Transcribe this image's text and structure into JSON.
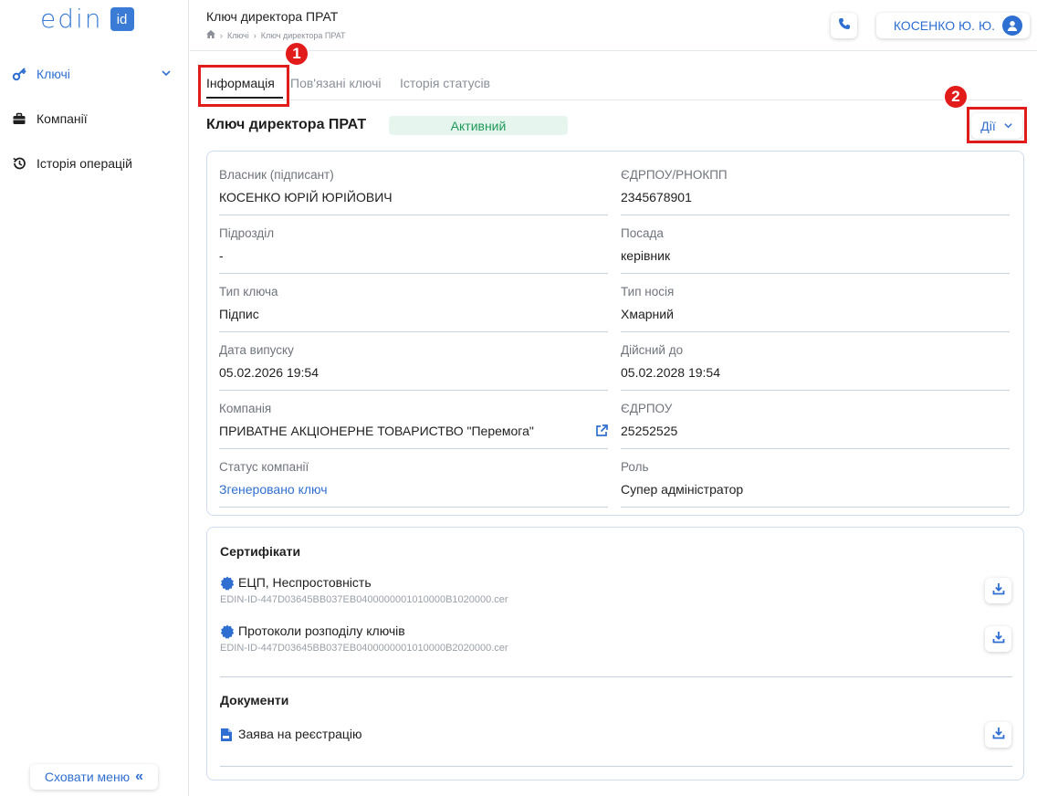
{
  "sidebar": {
    "logo_text": "edin",
    "logo_badge": "id",
    "items": [
      {
        "label": "Ключі",
        "icon": "key-icon"
      },
      {
        "label": "Компанії",
        "icon": "briefcase-icon"
      },
      {
        "label": "Історія операцій",
        "icon": "history-icon"
      }
    ],
    "hide_menu_label": "Сховати меню"
  },
  "header": {
    "title": "Ключ директора ПРАТ",
    "breadcrumb": [
      "Ключі",
      "Ключ директора ПРАТ"
    ],
    "user_label": "КОСЕНКО Ю. Ю."
  },
  "tabs": [
    "Інформація",
    "Пов'язані ключі",
    "Історія статусів"
  ],
  "key": {
    "title": "Ключ директора ПРАТ",
    "status": "Активний",
    "actions_label": "Дії"
  },
  "fields": {
    "owner": {
      "label": "Власник (підписант)",
      "value": "КОСЕНКО ЮРІЙ ЮРІЙОВИЧ"
    },
    "edrpou_rnokpp": {
      "label": "ЄДРПОУ/РНОКПП",
      "value": "2345678901"
    },
    "department": {
      "label": "Підрозділ",
      "value": "-"
    },
    "position": {
      "label": "Посада",
      "value": "керівник"
    },
    "key_type": {
      "label": "Тип ключа",
      "value": "Підпис"
    },
    "media_type": {
      "label": "Тип носія",
      "value": "Хмарний"
    },
    "issue_date": {
      "label": "Дата випуску",
      "value": "05.02.2026 19:54"
    },
    "valid_until": {
      "label": "Дійсний до",
      "value": "05.02.2028 19:54"
    },
    "company": {
      "label": "Компанія",
      "value": "ПРИВАТНЕ АКЦІОНЕРНЕ ТОВАРИСТВО \"Перемога\""
    },
    "edrpou": {
      "label": "ЄДРПОУ",
      "value": "25252525"
    },
    "company_status": {
      "label": "Статус компанії",
      "value": "Згенеровано ключ"
    },
    "role": {
      "label": "Роль",
      "value": "Супер адміністратор"
    }
  },
  "certificates": {
    "title": "Сертифікати",
    "items": [
      {
        "name": "ЕЦП, Неспростовність",
        "file": "EDIN-ID-447D03645BB037EB0400000001010000B1020000.cer"
      },
      {
        "name": "Протоколи розподілу ключів",
        "file": "EDIN-ID-447D03645BB037EB0400000001010000B2020000.cer"
      }
    ]
  },
  "documents": {
    "title": "Документи",
    "items": [
      {
        "name": "Заява на реєстрацію"
      }
    ]
  },
  "annotations": [
    "1",
    "2"
  ],
  "colors": {
    "accent": "#2f6fd1",
    "status_green": "#1f9a5a",
    "status_bg": "#e6f6ee",
    "annotation_red": "#e21b1b"
  }
}
